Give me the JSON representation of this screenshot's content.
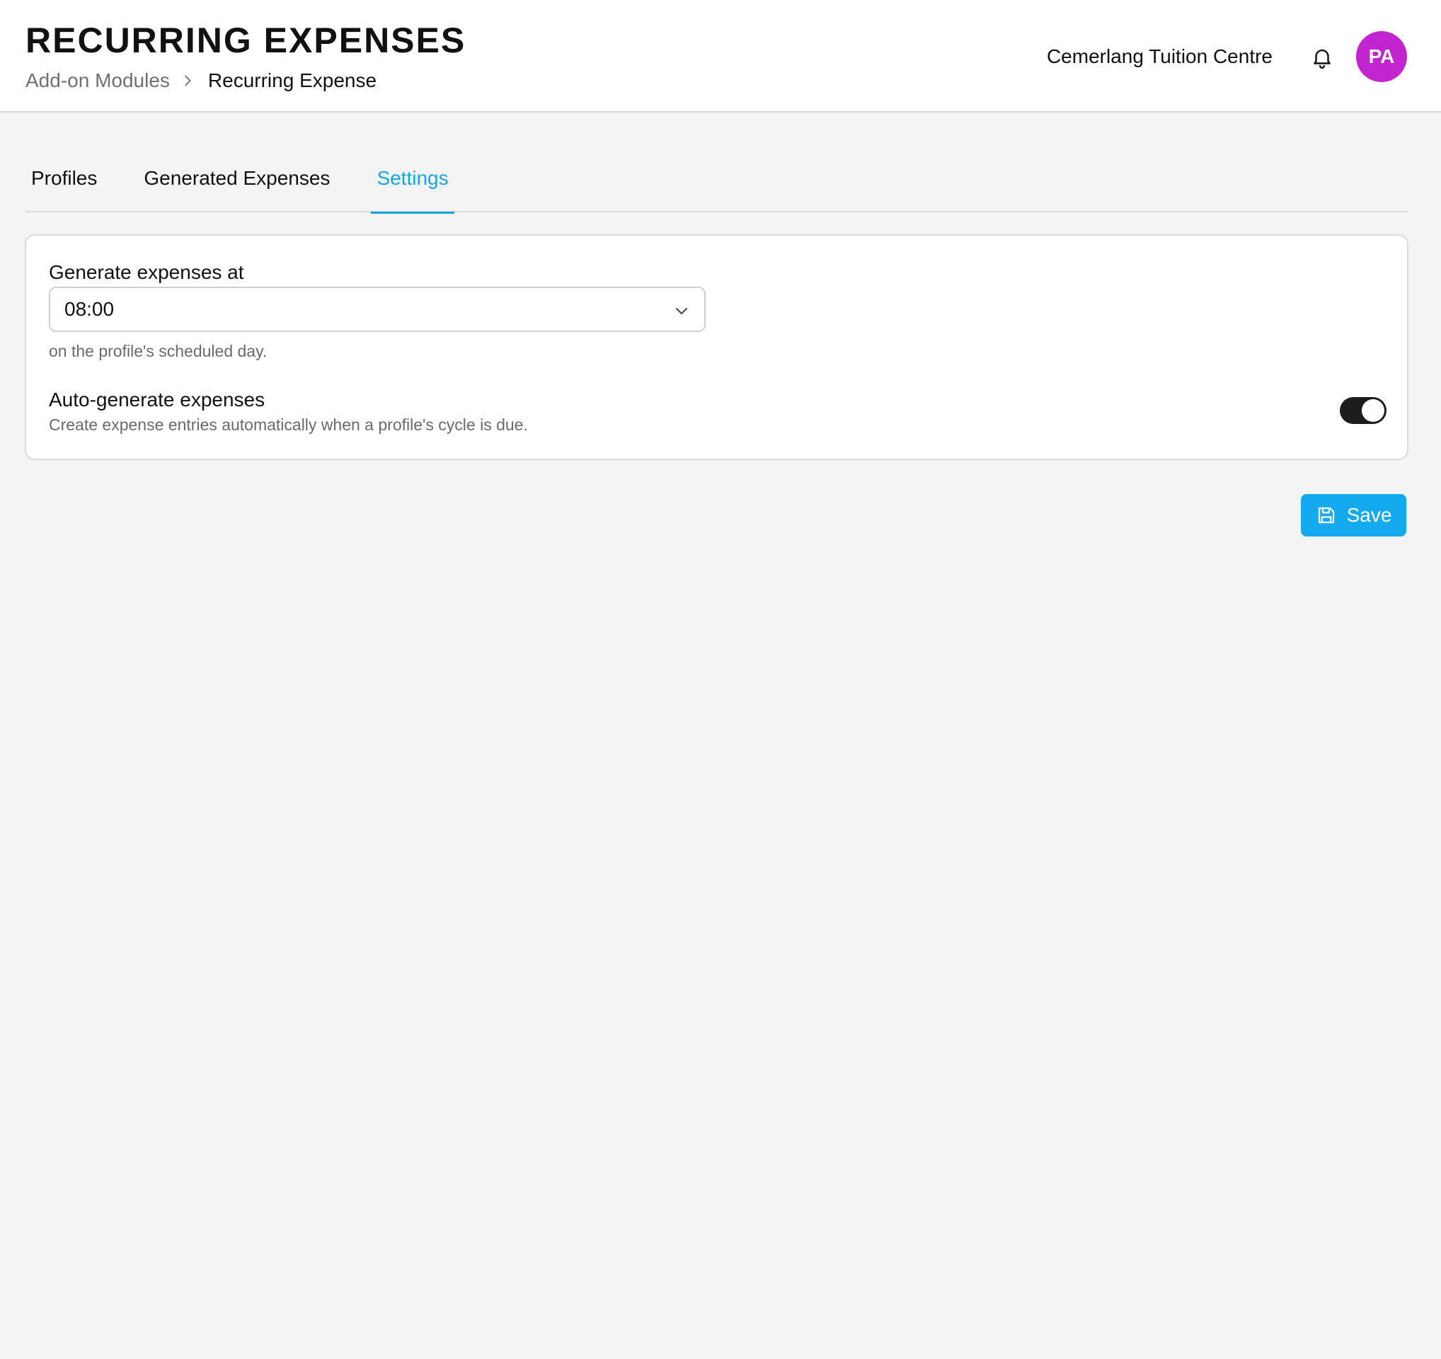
{
  "header": {
    "title": "RECURRING EXPENSES",
    "breadcrumb": {
      "parent": "Add-on Modules",
      "current": "Recurring Expense"
    },
    "organization": "Cemerlang Tuition Centre",
    "notifications_icon": "bell-icon",
    "avatar_initials": "PA",
    "avatar_color": "#c225cf"
  },
  "tabs": [
    {
      "label": "Profiles",
      "active": false
    },
    {
      "label": "Generated Expenses",
      "active": false
    },
    {
      "label": "Settings",
      "active": true
    }
  ],
  "settings": {
    "generate_at": {
      "label": "Generate expenses at",
      "value": "08:00",
      "helper": "on the profile's scheduled day."
    },
    "auto_generate": {
      "title": "Auto-generate expenses",
      "description": "Create expense entries automatically when a profile's cycle is due.",
      "enabled": true
    }
  },
  "actions": {
    "save_label": "Save",
    "save_icon": "floppy-disk-icon"
  },
  "colors": {
    "accent": "#14a6e6",
    "button": "#14aaf0",
    "toggle_on": "#1c1d1f"
  }
}
